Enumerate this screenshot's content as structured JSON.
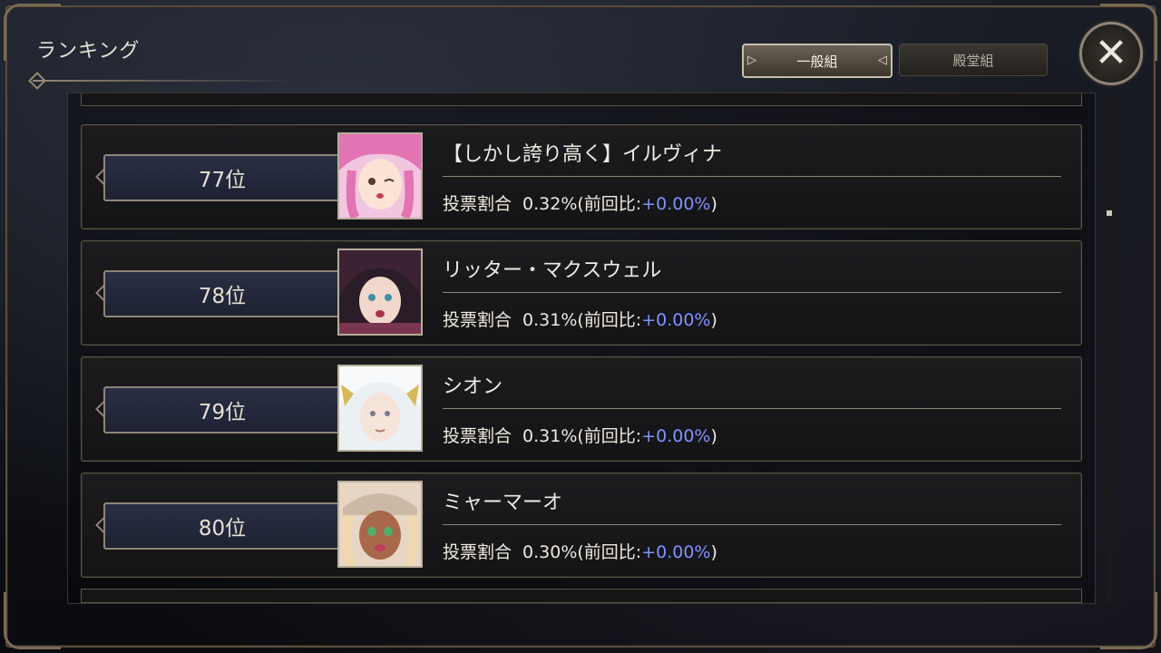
{
  "header": {
    "title": "ランキング",
    "tabs": [
      {
        "label": "一般組",
        "active": true
      },
      {
        "label": "殿堂組",
        "active": false
      }
    ],
    "close_label": "✕"
  },
  "ranking": {
    "vote_label": "投票割合",
    "prev_prefix": "(前回比:",
    "prev_suffix": ")",
    "entries": [
      {
        "rank": "77位",
        "name": "【しかし誇り高く】イルヴィナ",
        "share": "0.32%",
        "change": "+0.00%",
        "portrait_color": "#e78ac0"
      },
      {
        "rank": "78位",
        "name": "リッター・マクスウェル",
        "share": "0.31%",
        "change": "+0.00%",
        "portrait_color": "#4a2a3a"
      },
      {
        "rank": "79位",
        "name": "シオン",
        "share": "0.31%",
        "change": "+0.00%",
        "portrait_color": "#dfe6ee"
      },
      {
        "rank": "80位",
        "name": "ミャーマーオ",
        "share": "0.30%",
        "change": "+0.00%",
        "portrait_color": "#c8956e"
      }
    ]
  },
  "colors": {
    "accent_blue": "#7f93ff",
    "frame": "#8e8676"
  }
}
